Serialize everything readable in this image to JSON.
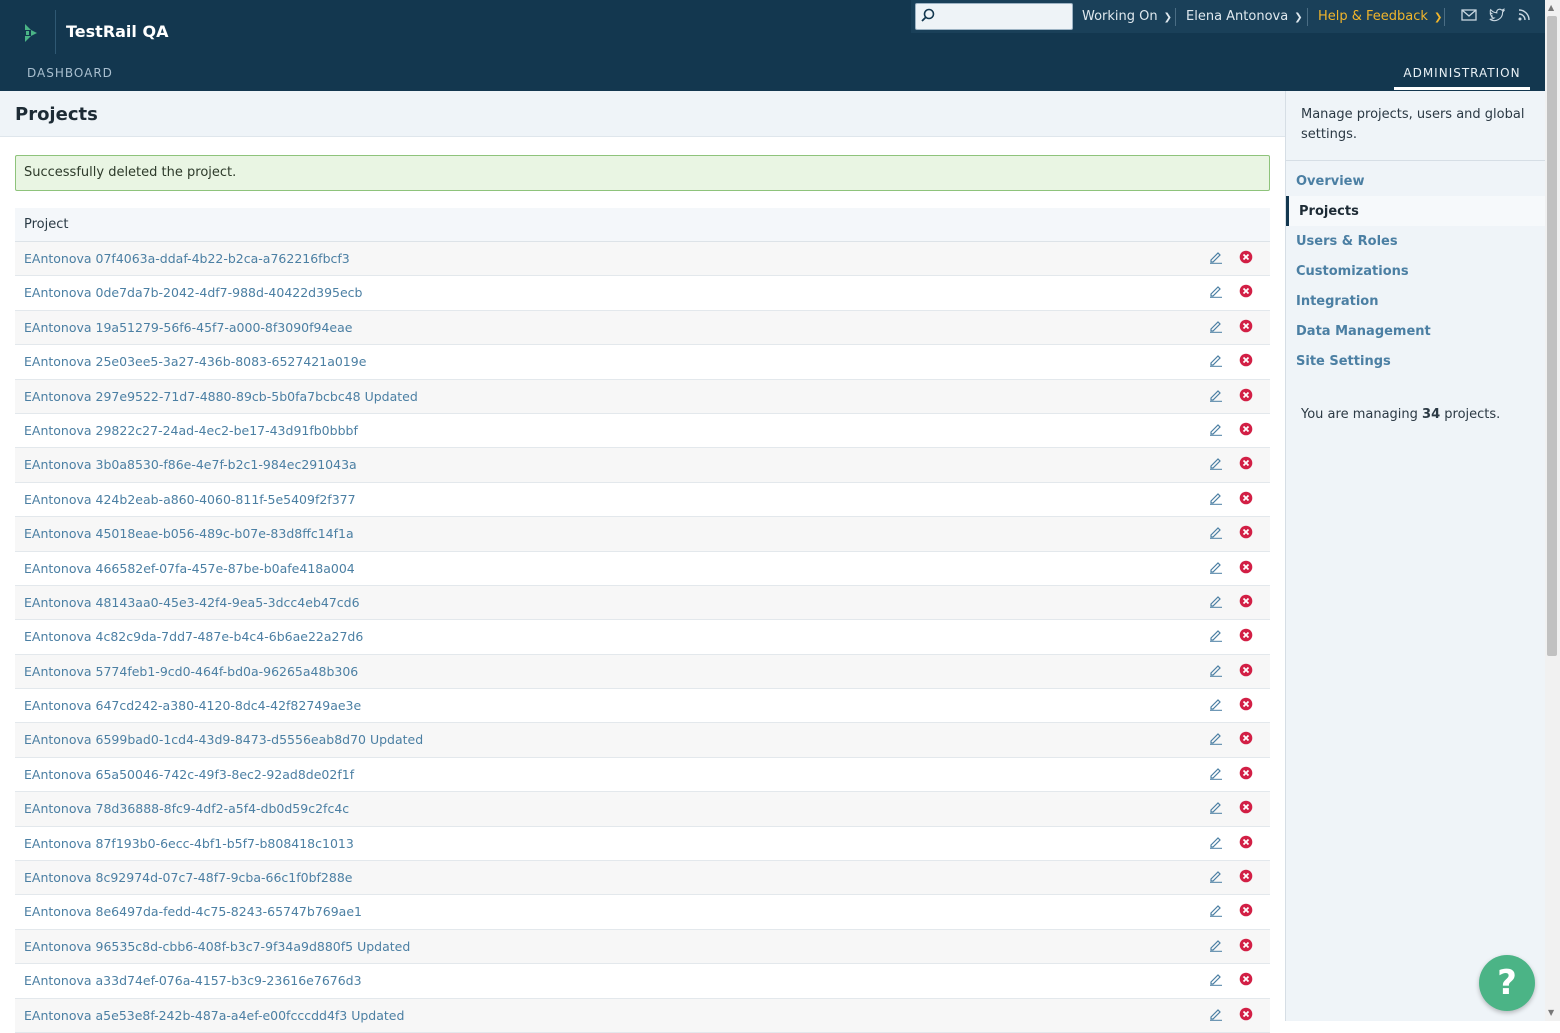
{
  "header": {
    "app_title": "TestRail QA",
    "nav_dashboard": "DASHBOARD",
    "nav_administration": "ADMINISTRATION",
    "search_placeholder": "",
    "working_on": "Working On",
    "user_name": "Elena Antonova",
    "help_feedback": "Help & Feedback",
    "colors": {
      "bar": "#13374f",
      "help": "#f1b52b"
    }
  },
  "page": {
    "title": "Projects",
    "success_message": "Successfully deleted the project.",
    "table_header": "Project",
    "projects": [
      "EAntonova 07f4063a-ddaf-4b22-b2ca-a762216fbcf3",
      "EAntonova 0de7da7b-2042-4df7-988d-40422d395ecb",
      "EAntonova 19a51279-56f6-45f7-a000-8f3090f94eae",
      "EAntonova 25e03ee5-3a27-436b-8083-6527421a019e",
      "EAntonova 297e9522-71d7-4880-89cb-5b0fa7bcbc48 Updated",
      "EAntonova 29822c27-24ad-4ec2-be17-43d91fb0bbbf",
      "EAntonova 3b0a8530-f86e-4e7f-b2c1-984ec291043a",
      "EAntonova 424b2eab-a860-4060-811f-5e5409f2f377",
      "EAntonova 45018eae-b056-489c-b07e-83d8ffc14f1a",
      "EAntonova 466582ef-07fa-457e-87be-b0afe418a004",
      "EAntonova 48143aa0-45e3-42f4-9ea5-3dcc4eb47cd6",
      "EAntonova 4c82c9da-7dd7-487e-b4c4-6b6ae22a27d6",
      "EAntonova 5774feb1-9cd0-464f-bd0a-96265a48b306",
      "EAntonova 647cd242-a380-4120-8dc4-42f82749ae3e",
      "EAntonova 6599bad0-1cd4-43d9-8473-d5556eab8d70 Updated",
      "EAntonova 65a50046-742c-49f3-8ec2-92ad8de02f1f",
      "EAntonova 78d36888-8fc9-4df2-a5f4-db0d59c2fc4c",
      "EAntonova 87f193b0-6ecc-4bf1-b5f7-b808418c1013",
      "EAntonova 8c92974d-07c7-48f7-9cba-66c1f0bf288e",
      "EAntonova 8e6497da-fedd-4c75-8243-65747b769ae1",
      "EAntonova 96535c8d-cbb6-408f-b3c7-9f34a9d880f5 Updated",
      "EAntonova a33d74ef-076a-4157-b3c9-23616e7676d3",
      "EAntonova a5e53e8f-242b-487a-a4ef-e00fcccdd4f3 Updated"
    ]
  },
  "sidebar": {
    "description": "Manage projects, users and global settings.",
    "items": [
      {
        "label": "Overview",
        "active": false
      },
      {
        "label": "Projects",
        "active": true
      },
      {
        "label": "Users & Roles",
        "active": false
      },
      {
        "label": "Customizations",
        "active": false
      },
      {
        "label": "Integration",
        "active": false
      },
      {
        "label": "Data Management",
        "active": false
      },
      {
        "label": "Site Settings",
        "active": false
      }
    ],
    "managing_prefix": "You are managing",
    "managing_count": "34",
    "managing_suffix": "projects."
  },
  "help_fab_label": "?"
}
